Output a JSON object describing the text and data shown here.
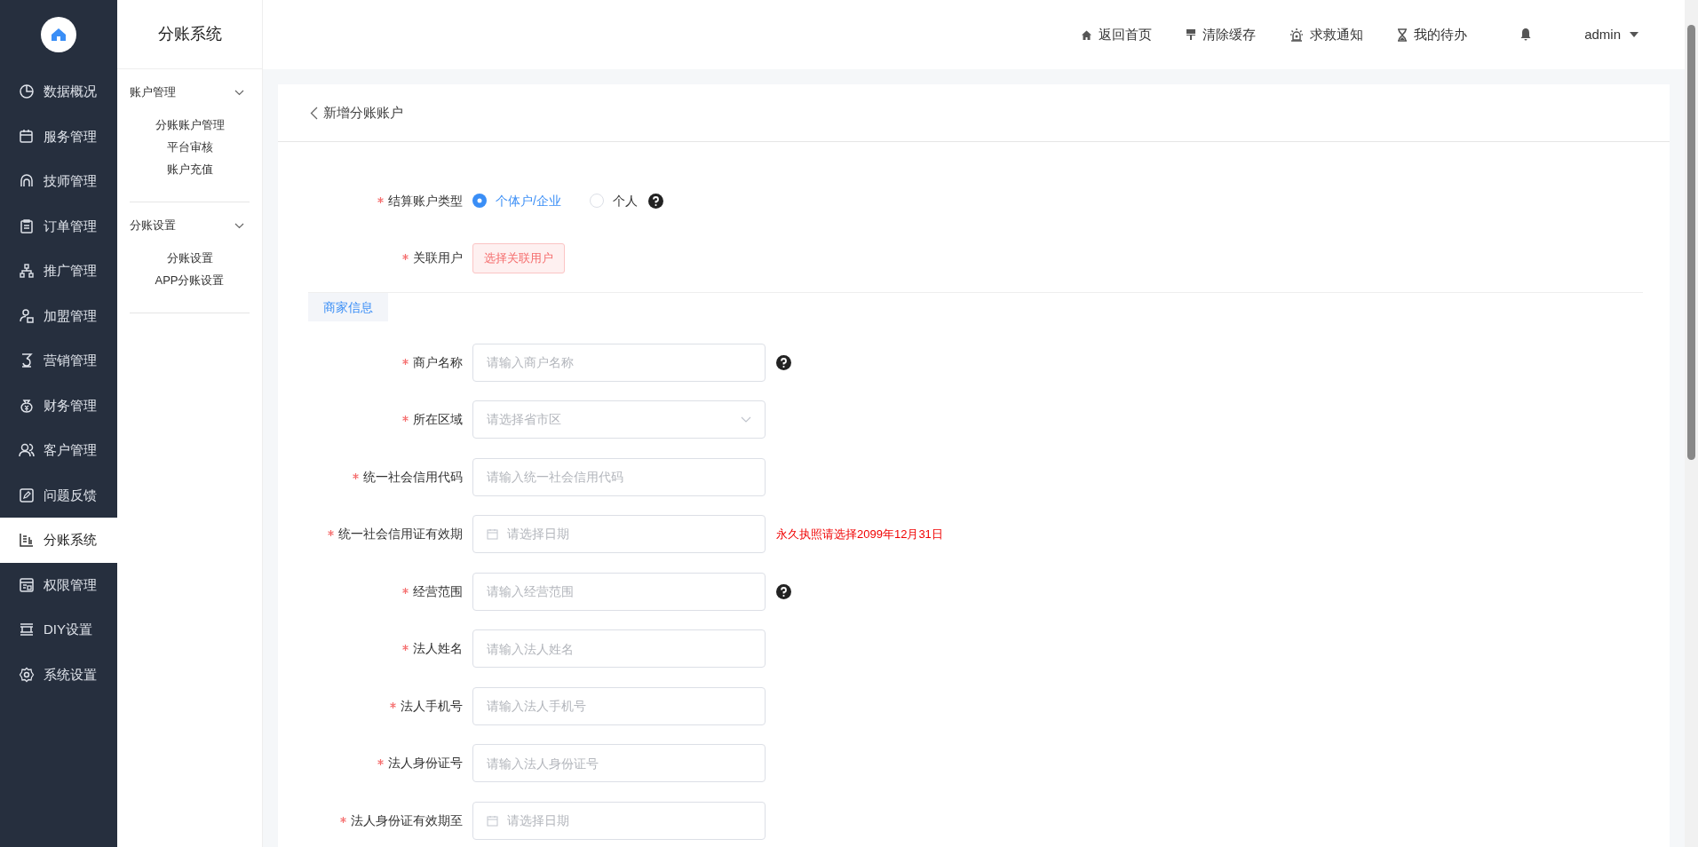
{
  "sidebar": {
    "items": [
      {
        "label": "数据概况",
        "selected": false
      },
      {
        "label": "服务管理",
        "selected": false
      },
      {
        "label": "技师管理",
        "selected": false
      },
      {
        "label": "订单管理",
        "selected": false
      },
      {
        "label": "推广管理",
        "selected": false
      },
      {
        "label": "加盟管理",
        "selected": false
      },
      {
        "label": "营销管理",
        "selected": false
      },
      {
        "label": "财务管理",
        "selected": false
      },
      {
        "label": "客户管理",
        "selected": false
      },
      {
        "label": "问题反馈",
        "selected": false
      },
      {
        "label": "分账系统",
        "selected": true
      },
      {
        "label": "权限管理",
        "selected": false
      },
      {
        "label": "DIY设置",
        "selected": false
      },
      {
        "label": "系统设置",
        "selected": false
      }
    ]
  },
  "submenu": {
    "title": "分账系统",
    "groups": [
      {
        "title": "账户管理",
        "expanded": true,
        "items": [
          "分账账户管理",
          "平台审核",
          "账户充值"
        ]
      },
      {
        "title": "分账设置",
        "expanded": true,
        "items": [
          "分账设置",
          "APP分账设置"
        ]
      }
    ]
  },
  "topbar": {
    "links": [
      "返回首页",
      "清除缓存",
      "求救通知",
      "我的待办"
    ],
    "user": "admin"
  },
  "page": {
    "title": "新增分账账户",
    "fields": [
      {
        "kind": "radio",
        "label": "结算账户类型",
        "required": true,
        "help": true,
        "options": [
          {
            "label": "个体户/企业",
            "selected": true
          },
          {
            "label": "个人",
            "selected": false
          }
        ]
      },
      {
        "kind": "button",
        "label": "关联用户",
        "required": true,
        "help": false,
        "button": "选择关联用户"
      },
      {
        "kind": "section",
        "label": "商家信息"
      },
      {
        "kind": "text",
        "label": "商户名称",
        "required": true,
        "help": true,
        "placeholder": "请输入商户名称"
      },
      {
        "kind": "select",
        "label": "所在区域",
        "required": true,
        "help": false,
        "placeholder": "请选择省市区"
      },
      {
        "kind": "text",
        "label": "统一社会信用代码",
        "required": true,
        "help": false,
        "placeholder": "请输入统一社会信用代码"
      },
      {
        "kind": "date",
        "label": "统一社会信用证有效期",
        "required": true,
        "help": false,
        "placeholder": "请选择日期",
        "note": "永久执照请选择2099年12月31日"
      },
      {
        "kind": "text",
        "label": "经营范围",
        "required": true,
        "help": true,
        "placeholder": "请输入经营范围"
      },
      {
        "kind": "text",
        "label": "法人姓名",
        "required": true,
        "help": false,
        "placeholder": "请输入法人姓名"
      },
      {
        "kind": "text",
        "label": "法人手机号",
        "required": true,
        "help": false,
        "placeholder": "请输入法人手机号"
      },
      {
        "kind": "text",
        "label": "法人身份证号",
        "required": true,
        "help": false,
        "placeholder": "请输入法人身份证号"
      },
      {
        "kind": "date",
        "label": "法人身份证有效期至",
        "required": true,
        "help": false,
        "placeholder": "请选择日期"
      }
    ]
  }
}
